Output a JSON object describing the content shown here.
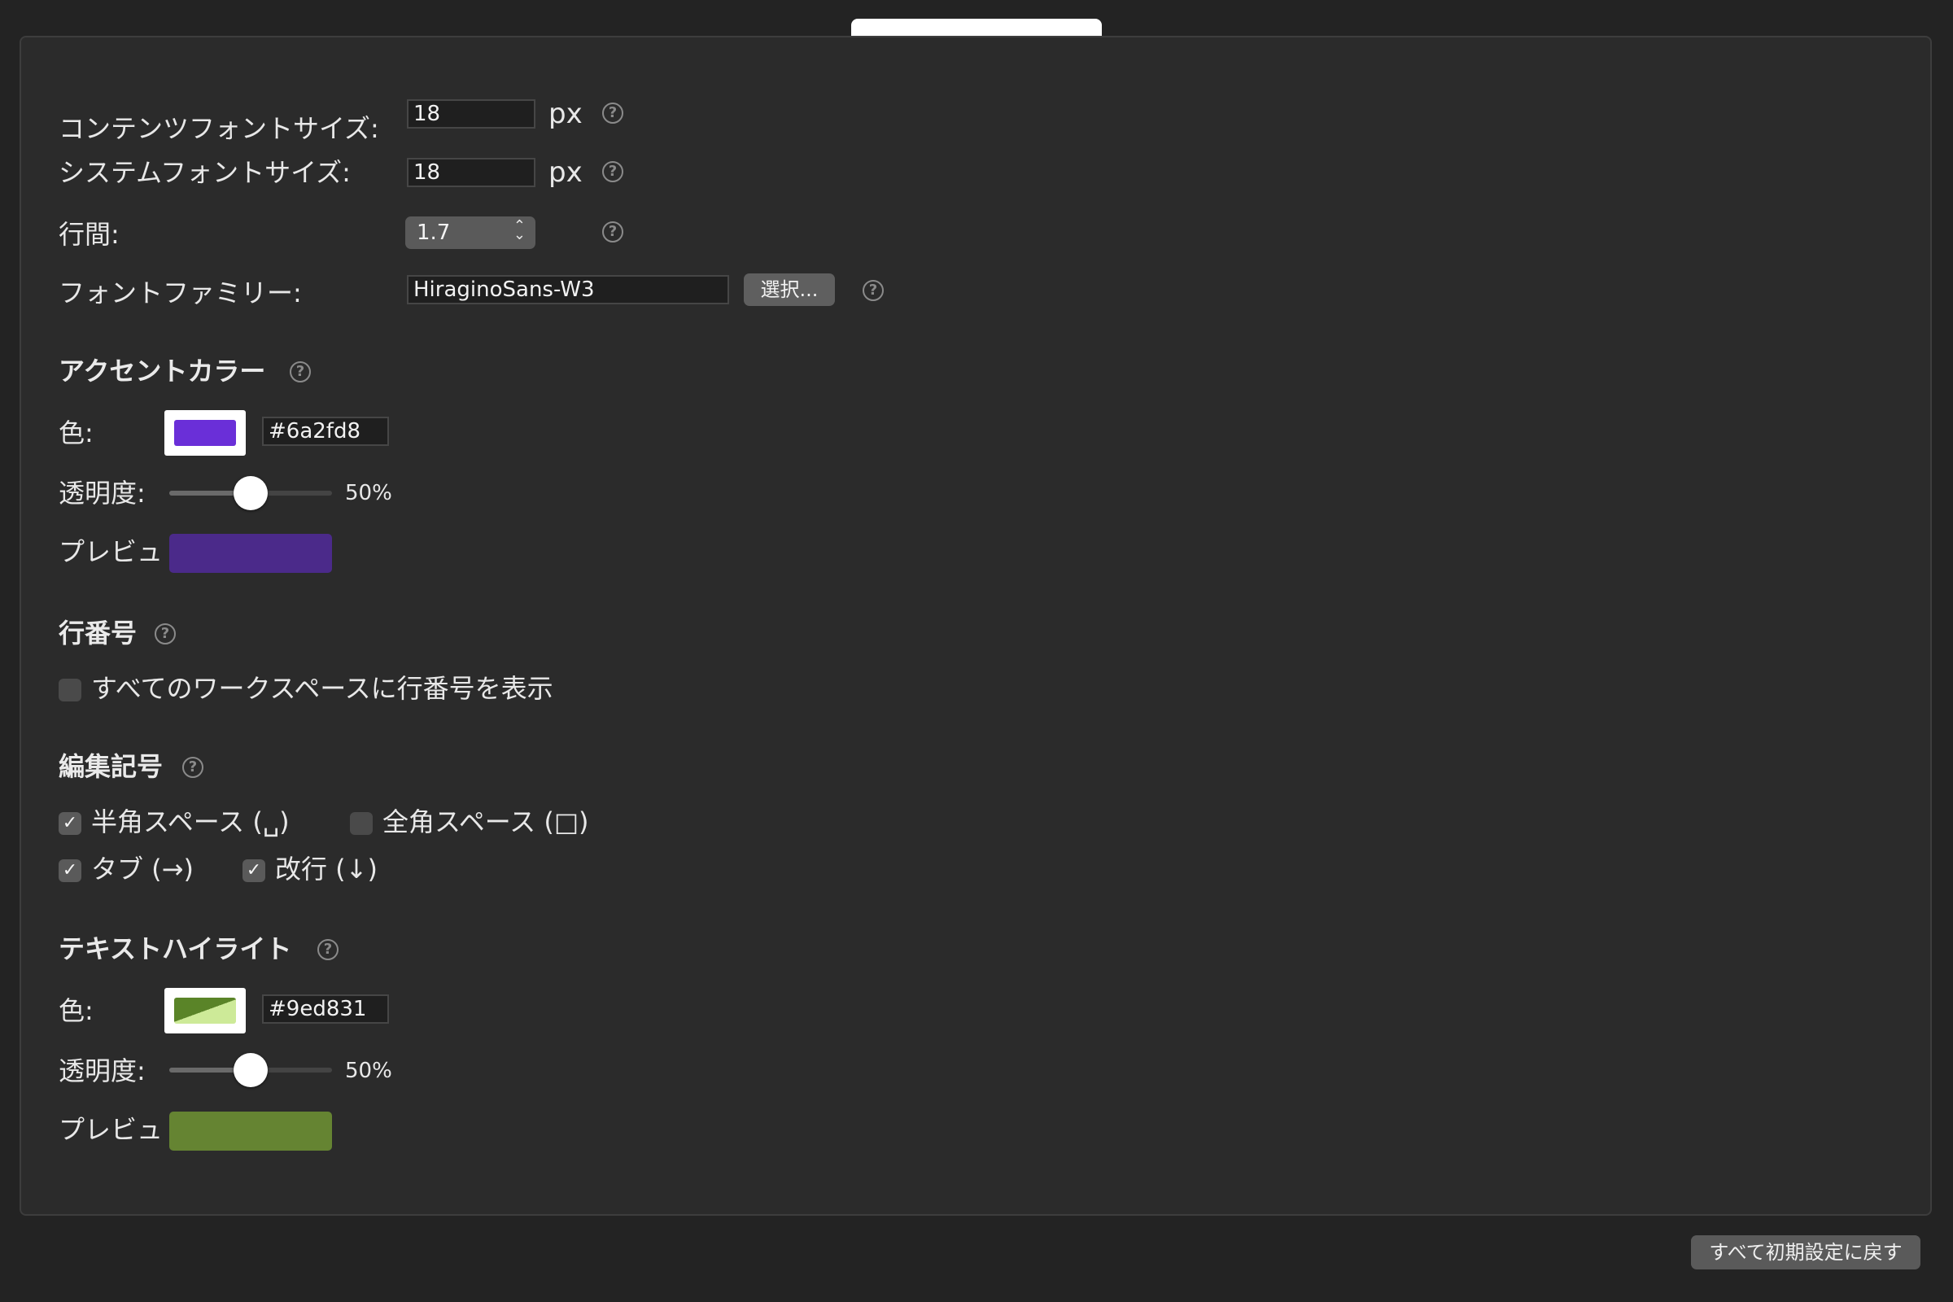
{
  "font": {
    "content_size_label": "コンテンツフォントサイズ:",
    "content_size_value": "18",
    "system_size_label": "システムフォントサイズ:",
    "system_size_value": "18",
    "unit": "px",
    "line_height_label": "行間:",
    "line_height_value": "1.7",
    "family_label": "フォントファミリー:",
    "family_value": "HiraginoSans-W3",
    "select_button": "選択..."
  },
  "accent": {
    "title": "アクセントカラー",
    "color_label": "色:",
    "color_hex": "#6a2fd8",
    "opacity_label": "透明度:",
    "opacity_value": 50,
    "opacity_text": "50%",
    "preview_label": "プレビュ",
    "swatch_color": "#6a2fd8",
    "preview_color": "#4b2a8a"
  },
  "line_numbers": {
    "title": "行番号",
    "show_all_label": "すべてのワークスペースに行番号を表示",
    "show_all_checked": false
  },
  "edit_marks": {
    "title": "編集記号",
    "half_space_label": "半角スペース (␣)",
    "half_space_checked": true,
    "full_space_label": "全角スペース (□)",
    "full_space_checked": false,
    "tab_label": "タブ (→)",
    "tab_checked": true,
    "newline_label": "改行 (↓)",
    "newline_checked": true
  },
  "highlight": {
    "title": "テキストハイライト",
    "color_label": "色:",
    "color_hex": "#9ed831",
    "opacity_label": "透明度:",
    "opacity_value": 50,
    "opacity_text": "50%",
    "preview_label": "プレビュ",
    "swatch_dark": "#5a8428",
    "swatch_light": "#cdea98",
    "preview_color": "#658432"
  },
  "footer": {
    "reset_button": "すべて初期設定に戻す"
  },
  "icons": {
    "help": "?",
    "check": "✓",
    "stepper_up": "⌃",
    "stepper_down": "⌄"
  }
}
